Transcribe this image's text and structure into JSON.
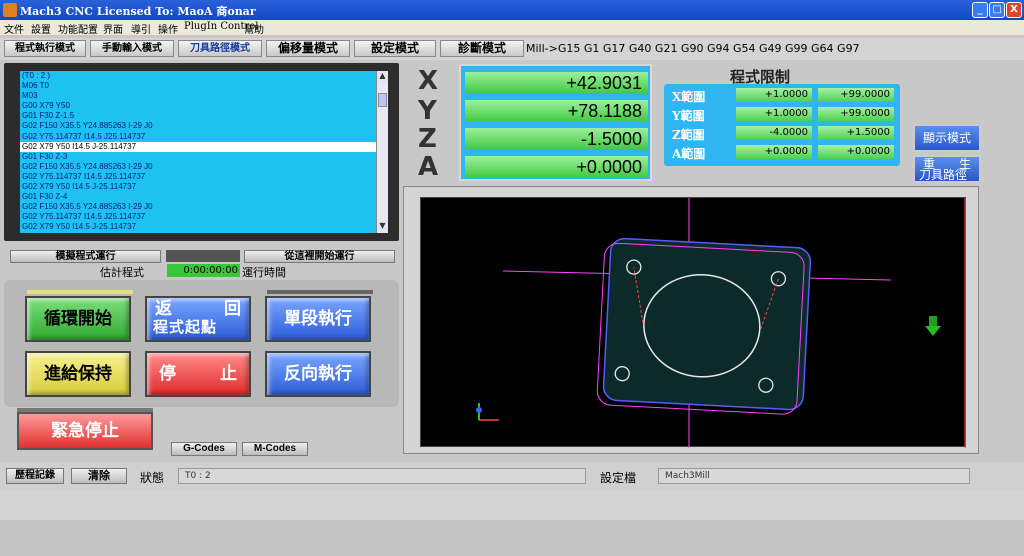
{
  "window": {
    "title": "Mach3 CNC  Licensed To: MaoA      商onar",
    "minimize": "_",
    "maximize": "□",
    "close": "X"
  },
  "menu": [
    "文件",
    "設置",
    "功能配置",
    "界面",
    "導引",
    "操作",
    "PlugIn Control",
    "幫助"
  ],
  "modes": {
    "program_run": "程式執行模式",
    "mdi": "手動輸入模式",
    "toolpath": "刀具路徑模式",
    "offsets": "偏移量模式",
    "settings": "設定模式",
    "diagnostics": "診斷模式"
  },
  "gcode_modal": "Mill->G15  G1 G17 G40 G21 G90 G94 G54 G49 G99 G64 G97",
  "gcode_lines": [
    "(T0 : 2 )",
    "M06 T0",
    "M03",
    "G00 X79 Y50",
    "G01 F30 Z-1.5",
    "G02 F150 X35.5 Y24.885263 I-29 J0",
    "G02 Y75.114737 I14.5 J25.114737",
    "G02 X79 Y50 I14.5 J-25.114737",
    "G01 F30 Z-3",
    "G02 F150 X35.5 Y24.885263 I-29 J0",
    "G02 Y75.114737 I14.5 J25.114737",
    "G02 X79 Y50 I14.5 J-25.114737",
    "G01 F30 Z-4",
    "G02 F150 X35.5 Y24.885263 I-29 J0",
    "G02 Y75.114737 I14.5 J25.114737",
    "G02 X79 Y50 I14.5 J-25.114737"
  ],
  "selected_line_index": 7,
  "sim": {
    "simulate_label": "模擬程式運行",
    "run_from_here_label": "從這裡開始運行",
    "estimate_label": "估計程式",
    "run_time": "0:00:00:00",
    "run_time_label": "運行時間"
  },
  "buttons": {
    "cycle_start": "循環開始",
    "return_home_1": "返",
    "return_home_2": "回",
    "return_home_3": "程式起點",
    "single_block": "單段執行",
    "feed_hold": "進給保持",
    "stop_1": "停",
    "stop_2": "止",
    "reverse_run": "反向執行",
    "emergency_stop": "緊急停止",
    "gcodes": "G-Codes",
    "mcodes": "M-Codes"
  },
  "dro": {
    "x_label": "X",
    "y_label": "Y",
    "z_label": "Z",
    "a_label": "A",
    "x": "+42.9031",
    "y": "+78.1188",
    "z": "-1.5000",
    "a": "+0.0000"
  },
  "limits": {
    "title": "程式限制",
    "x_label": "X範圍",
    "x_min": "+1.0000",
    "x_max": "+99.0000",
    "y_label": "Y範圍",
    "y_min": "+1.0000",
    "y_max": "+99.0000",
    "z_label": "Z範圍",
    "z_min": "-4.0000",
    "z_max": "+1.5000",
    "a_label": "A範圍",
    "a_min": "+0.0000",
    "a_max": "+0.0000"
  },
  "side_buttons": {
    "display_mode": "顯示模式",
    "regen_1": "重",
    "regen_2": "生",
    "regen_3": "刀具路徑"
  },
  "status": {
    "history_label": "歷程記錄",
    "clear_label": "清除",
    "status_label": "狀態",
    "status_value": "T0 : 2",
    "profile_label": "設定檔",
    "profile_value": "Mach3Mill"
  },
  "colors": {
    "dro_bg": "#2fb6f0",
    "dro_value_bg": "#3ec93e",
    "toolpath_bg": "#000000",
    "part_outline": "#5a5aff",
    "toolpath_line": "#ff40ff"
  }
}
